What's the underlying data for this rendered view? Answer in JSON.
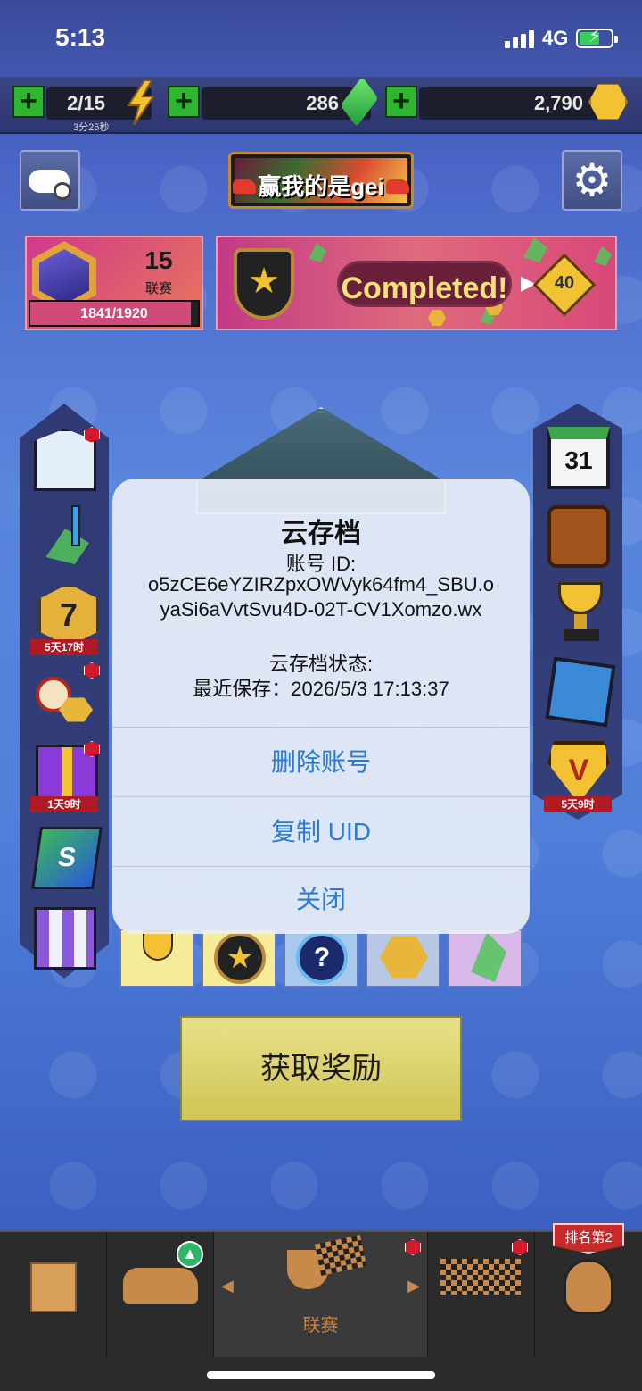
{
  "status_bar": {
    "time": "5:13",
    "network": "4G"
  },
  "resources": {
    "energy": {
      "value": "2/15",
      "timer": "3分25秒"
    },
    "gems": {
      "value": "286"
    },
    "coins": {
      "value": "2,790"
    }
  },
  "header": {
    "player_name": "赢我的是gei"
  },
  "league_card": {
    "level": "15",
    "label": "联赛",
    "progress_text": "1841/1920",
    "progress_fraction": 0.9589
  },
  "event_banner": {
    "status": "Completed!",
    "reward": "40"
  },
  "left_sidebar": {
    "timers": [
      "5天17时",
      "1天9时"
    ]
  },
  "right_sidebar": {
    "calendar_day": "31",
    "timer": "5天9时"
  },
  "claim_button": {
    "label": "获取奖励"
  },
  "dialog": {
    "title": "云存档",
    "account_label": "账号 ID:",
    "account_id_line1": "o5zCE6eYZIRZpxOWVyk64fm4_SBU.o",
    "account_id_line2": "yaSi6aVvtSvu4D-02T-CV1Xomzo.wx",
    "save_status_label": "云存档状态:",
    "last_saved": "最近保存：2026/5/3 17:13:37",
    "buttons": {
      "delete": "删除账号",
      "copy": "复制 UID",
      "close": "关闭"
    }
  },
  "bottom_nav": {
    "active_label": "联赛",
    "rank_badge": "排名第2"
  },
  "colors": {
    "dialog_button": "#2a7ad8",
    "plus_button": "#2fb52f",
    "claim_button": "#dcd46e"
  }
}
